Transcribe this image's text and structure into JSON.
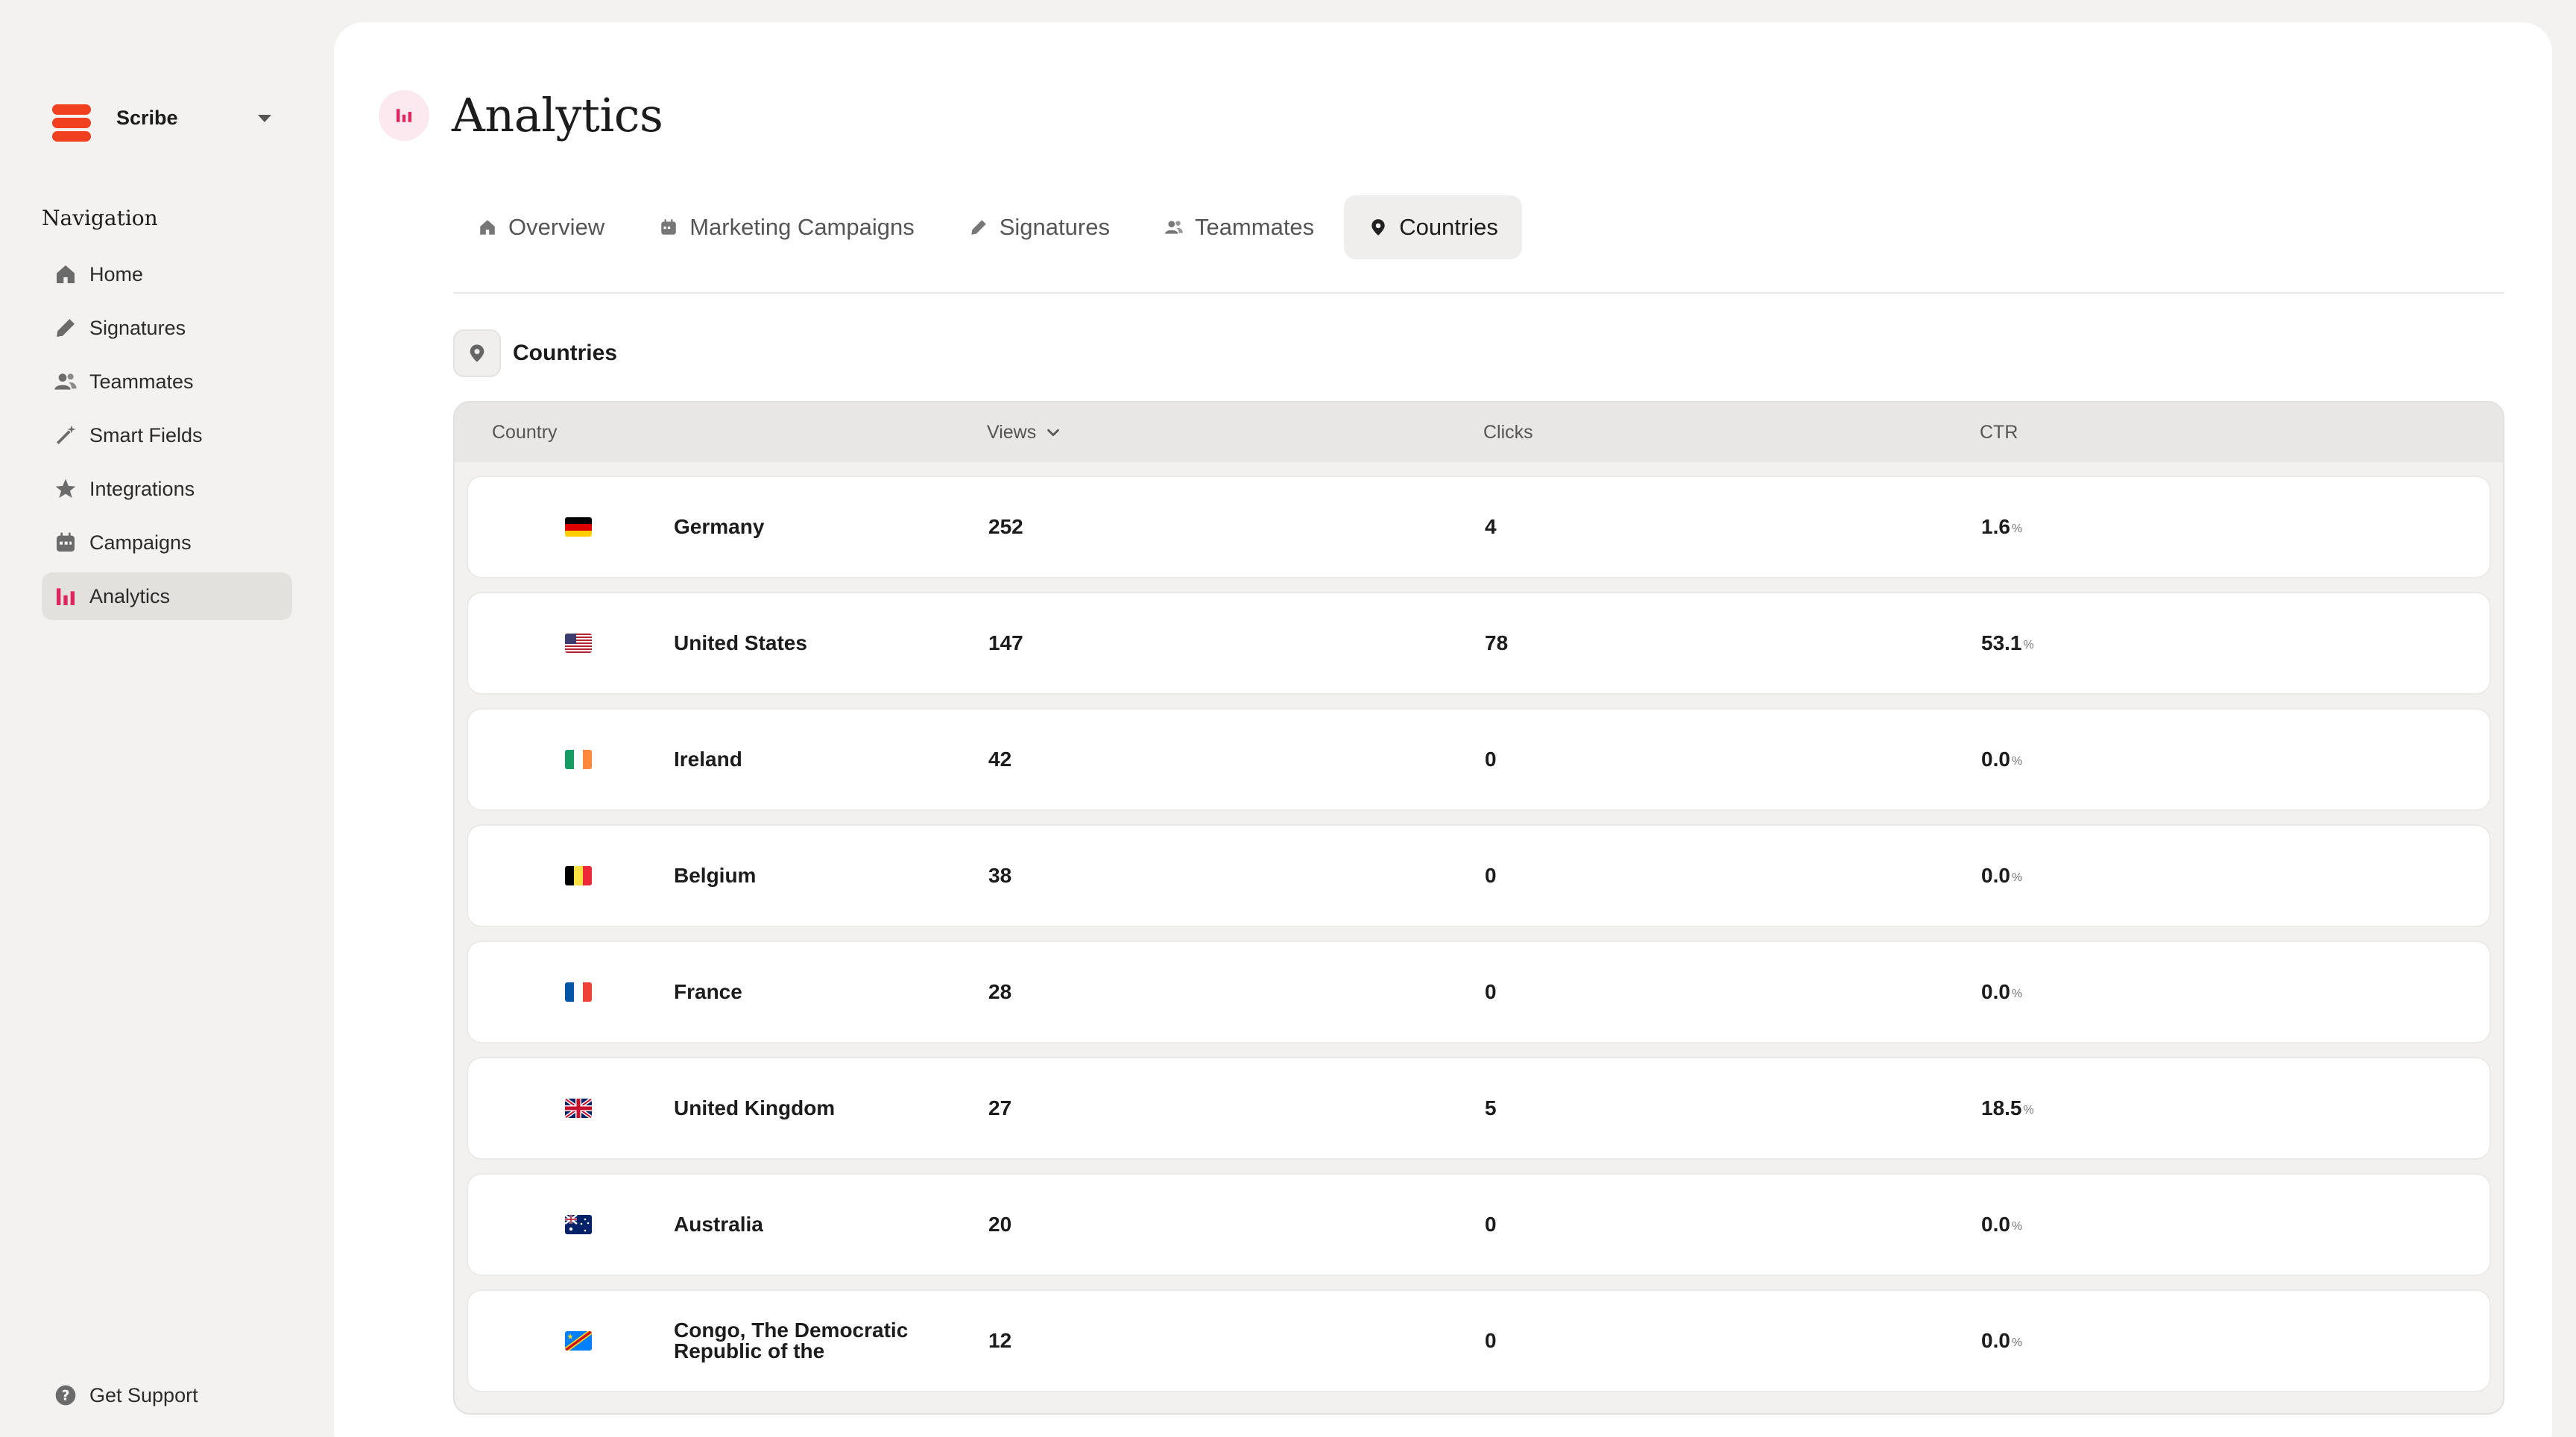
{
  "brand": {
    "name": "Scribe"
  },
  "sidebar": {
    "heading": "Navigation",
    "items": [
      {
        "label": "Home",
        "icon": "home-icon"
      },
      {
        "label": "Signatures",
        "icon": "pen-icon"
      },
      {
        "label": "Teammates",
        "icon": "users-icon"
      },
      {
        "label": "Smart Fields",
        "icon": "wand-icon"
      },
      {
        "label": "Integrations",
        "icon": "star-icon"
      },
      {
        "label": "Campaigns",
        "icon": "calendar-icon"
      },
      {
        "label": "Analytics",
        "icon": "chart-bar-icon",
        "active": true
      }
    ],
    "support_label": "Get Support"
  },
  "page": {
    "title": "Analytics"
  },
  "tabs": [
    {
      "label": "Overview",
      "icon": "home-icon"
    },
    {
      "label": "Marketing Campaigns",
      "icon": "calendar-icon"
    },
    {
      "label": "Signatures",
      "icon": "pen-icon"
    },
    {
      "label": "Teammates",
      "icon": "users-icon"
    },
    {
      "label": "Countries",
      "icon": "location-pin-icon",
      "active": true
    }
  ],
  "section": {
    "title": "Countries"
  },
  "table": {
    "columns": {
      "country": "Country",
      "views": "Views",
      "clicks": "Clicks",
      "ctr": "CTR"
    },
    "rows": [
      {
        "country": "Germany",
        "flag": "de",
        "views": "252",
        "clicks": "4",
        "ctr": "1.6",
        "unit": "%"
      },
      {
        "country": "United States",
        "flag": "us",
        "views": "147",
        "clicks": "78",
        "ctr": "53.1",
        "unit": "%"
      },
      {
        "country": "Ireland",
        "flag": "ie",
        "views": "42",
        "clicks": "0",
        "ctr": "0.0",
        "unit": "%"
      },
      {
        "country": "Belgium",
        "flag": "be",
        "views": "38",
        "clicks": "0",
        "ctr": "0.0",
        "unit": "%"
      },
      {
        "country": "France",
        "flag": "fr",
        "views": "28",
        "clicks": "0",
        "ctr": "0.0",
        "unit": "%"
      },
      {
        "country": "United Kingdom",
        "flag": "gb",
        "views": "27",
        "clicks": "5",
        "ctr": "18.5",
        "unit": "%"
      },
      {
        "country": "Australia",
        "flag": "au",
        "views": "20",
        "clicks": "0",
        "ctr": "0.0",
        "unit": "%"
      },
      {
        "country": "Congo, The Democratic Republic of the",
        "flag": "cd",
        "views": "12",
        "clicks": "0",
        "ctr": "0.0",
        "unit": "%"
      }
    ]
  },
  "colors": {
    "brand": "#f0401f",
    "accent": "#e0245e"
  }
}
